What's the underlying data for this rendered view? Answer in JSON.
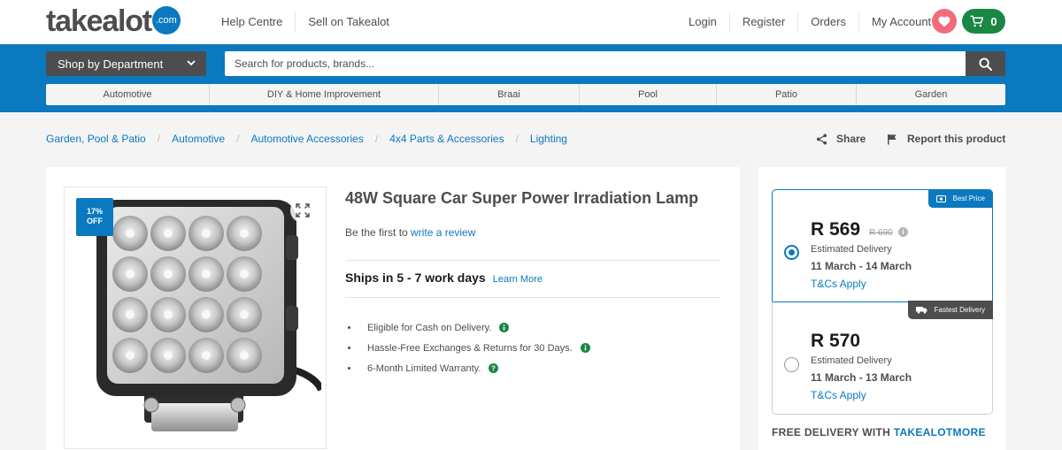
{
  "header": {
    "logo_text": "takealot",
    "logo_dot": ".com",
    "help_centre": "Help Centre",
    "sell": "Sell on Takealot",
    "login": "Login",
    "register": "Register",
    "orders": "Orders",
    "my_account": "My Account",
    "cart_count": "0",
    "brand_blue": "#0b79bf",
    "cart_green": "#1a8744",
    "wishlist_pink": "#f26b7a"
  },
  "search": {
    "dept_label": "Shop by Department",
    "placeholder": "Search for products, brands..."
  },
  "categories": [
    "Automotive",
    "DIY & Home Improvement",
    "Braai",
    "Pool",
    "Patio",
    "Garden"
  ],
  "breadcrumb": [
    "Garden, Pool & Patio",
    "Automotive",
    "Automotive Accessories",
    "4x4 Parts & Accessories",
    "Lighting"
  ],
  "actions": {
    "share": "Share",
    "report": "Report this product"
  },
  "product": {
    "discount": "17%",
    "discount_suffix": "OFF",
    "title": "48W Square Car Super Power Irradiation Lamp",
    "review_prefix": "Be the first to",
    "review_link": "write a review",
    "shipping": "Ships in 5 - 7 work days",
    "learn_more": "Learn More",
    "features": [
      {
        "text": "Eligible for Cash on Delivery.",
        "icon": "info-icon"
      },
      {
        "text": "Hassle-Free Exchanges & Returns for 30 Days.",
        "icon": "info-icon"
      },
      {
        "text": "6-Month Limited Warranty.",
        "icon": "question-icon"
      }
    ]
  },
  "offers": [
    {
      "tag": "Best Price",
      "price": "R 569",
      "old_price": "R 690",
      "est_label": "Estimated Delivery",
      "dates": "11 March - 14 March",
      "tcs": "T&Cs Apply",
      "selected": true
    },
    {
      "tag": "Fastest Delivery",
      "price": "R 570",
      "est_label": "Estimated Delivery",
      "dates": "11 March - 13 March",
      "tcs": "T&Cs Apply",
      "selected": false
    }
  ],
  "free_delivery": {
    "prefix": "FREE DELIVERY WITH",
    "brand": "TAKEALOTMORE"
  }
}
